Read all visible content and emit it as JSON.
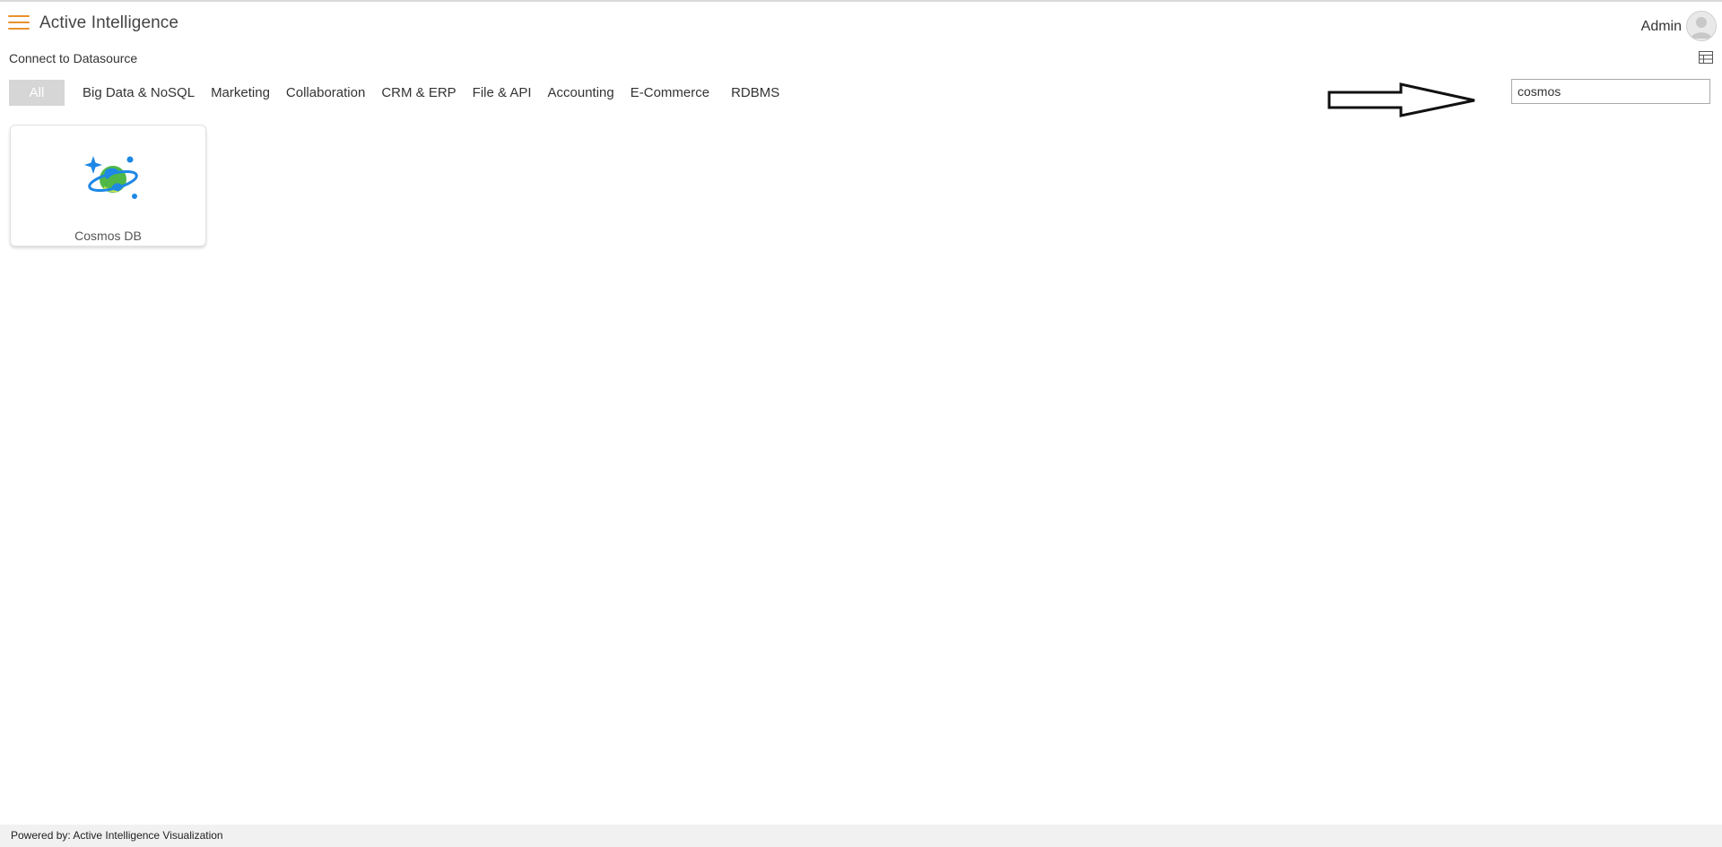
{
  "header": {
    "app_title": "Active Intelligence",
    "user_name": "Admin"
  },
  "page": {
    "section_title": "Connect to Datasource"
  },
  "tabs": [
    {
      "label": "All",
      "active": true
    },
    {
      "label": "Big Data & NoSQL"
    },
    {
      "label": "Marketing"
    },
    {
      "label": "Collaboration"
    },
    {
      "label": "CRM & ERP"
    },
    {
      "label": "File & API"
    },
    {
      "label": "Accounting"
    },
    {
      "label": "E-Commerce"
    },
    {
      "label": "RDBMS"
    }
  ],
  "search": {
    "value": "cosmos"
  },
  "results": [
    {
      "label": "Cosmos DB",
      "icon": "cosmos-db-icon"
    }
  ],
  "footer": {
    "text": "Powered by: Active Intelligence Visualization"
  },
  "colors": {
    "accent": "#e8912d",
    "active_tab_bg": "#d6d6d6",
    "footer_bg": "#f1f1f1"
  },
  "icons": {
    "menu": "hamburger-menu-icon",
    "avatar": "user-avatar-icon",
    "view_toggle": "table-grid-icon",
    "annotation": "right-arrow-icon"
  }
}
